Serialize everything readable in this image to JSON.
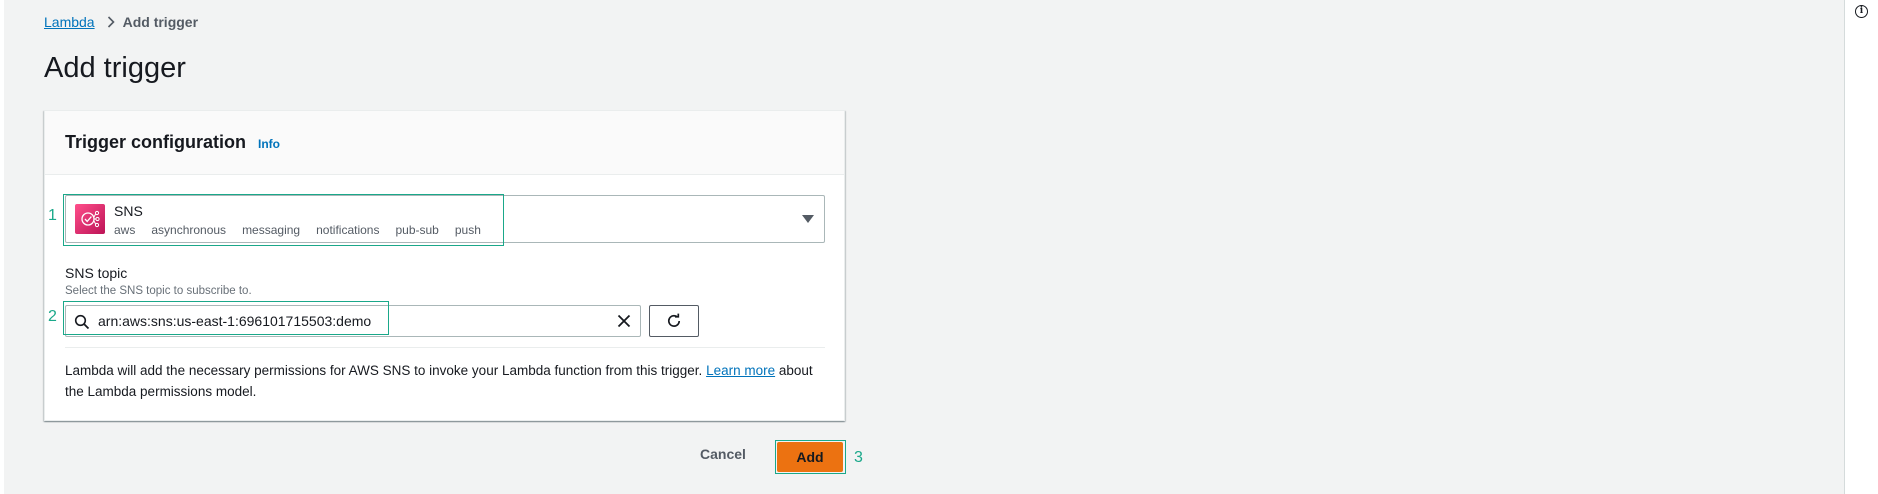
{
  "breadcrumb": {
    "root": "Lambda",
    "current": "Add trigger"
  },
  "page": {
    "title": "Add trigger"
  },
  "panel": {
    "title": "Trigger configuration",
    "info": "Info"
  },
  "source": {
    "label": "SNS",
    "tags": [
      "aws",
      "asynchronous",
      "messaging",
      "notifications",
      "pub-sub",
      "push"
    ],
    "icon": "sns-service-icon",
    "icon_color": "#d6336c"
  },
  "topic": {
    "label": "SNS topic",
    "description": "Select the SNS topic to subscribe to.",
    "value": "arn:aws:sns:us-east-1:696101715503:demo"
  },
  "notice": {
    "text": "Lambda will add the necessary permissions for AWS SNS to invoke your Lambda function from this trigger.",
    "link": "Learn more",
    "suffix": "about the Lambda permissions model."
  },
  "actions": {
    "cancel": "Cancel",
    "add": "Add"
  },
  "annotations": [
    "1",
    "2",
    "3"
  ],
  "colors": {
    "primary": "#ec7211",
    "link": "#0073bb",
    "annotation": "#1aa88a"
  }
}
